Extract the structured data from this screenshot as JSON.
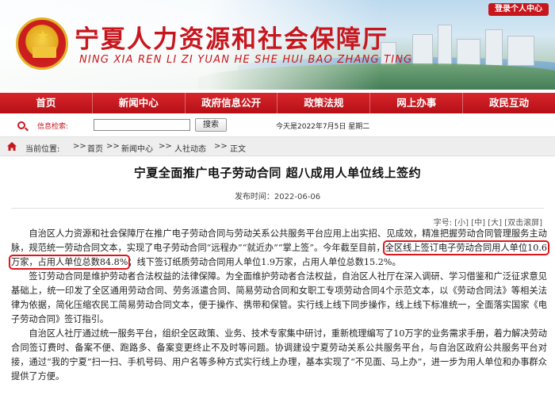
{
  "header": {
    "site_title": "宁夏人力资源和社会保障厅",
    "site_pinyin": "NING XIA REN LI ZI YUAN HE SHE HUI BAO ZHANG TING",
    "login_label": "登录个人中心"
  },
  "nav": {
    "items": [
      {
        "label": "首页"
      },
      {
        "label": "新闻中心"
      },
      {
        "label": "政府信息公开"
      },
      {
        "label": "政策法规"
      },
      {
        "label": "网上办事"
      },
      {
        "label": "政民互动"
      }
    ]
  },
  "search": {
    "label": "信息检索:",
    "value": "",
    "button": "搜索",
    "date_text": "今天是2022年7月5日 星期二"
  },
  "breadcrumb": {
    "label": "当前位置:",
    "items": [
      "首页",
      "新闻中心",
      "人社动态",
      "正文"
    ],
    "sep": ">>"
  },
  "article": {
    "title": "宁夏全面推广电子劳动合同 超八成用人单位线上签约",
    "pub_time": "发布时间：2022-06-06",
    "font_size_label": "字号: [小] [中] [大] [双击滚屏]",
    "p1_a": "自治区人力资源和社会保障厅在推广电子劳动合同与劳动关系公共服务平台应用上出实招、见成效，精准把握劳动合同管理服务主动脉，规范统一劳动合同文本，实现了电子劳动合同“远程办”“就近办”“掌上签”。今年截至目前，",
    "p1_hl": "全区线上签订电子劳动合同用人单位10.6万家，占用人单位总数84.8%",
    "p1_b": "；线下签订纸质劳动合同用人单位1.9万家，占用人单位总数15.2%。",
    "p2": "签订劳动合同是维护劳动者合法权益的法律保障。为全面维护劳动者合法权益，自治区人社厅在深入调研、学习借鉴和广泛征求意见基础上，统一印发了全区通用劳动合同、劳务派遣合同、简易劳动合同和女职工专项劳动合同4个示范文本，以《劳动合同法》等相关法律为依据，简化压缩农民工简易劳动合同文本，便于操作、携带和保管。实行线上线下同步操作，线上线下标准统一，全面落实国家《电子劳动合同》签订指引。",
    "p3": "自治区人社厅通过统一服务平台，组织全区政策、业务、技术专家集中研讨，重新梳理编写了10万字的业务需求手册，着力解决劳动合同签订费时、备案不便、跑路多、备案变更终止不及时等问题。协调建设宁夏劳动关系公共服务平台，与自治区政府公共服务平台对接，通过“我的宁夏”扫一扫、手机号码、用户名等多种方式实行线上办理，基本实现了“不见面、马上办”，进一步为用人单位和办事群众提供了方便。"
  }
}
